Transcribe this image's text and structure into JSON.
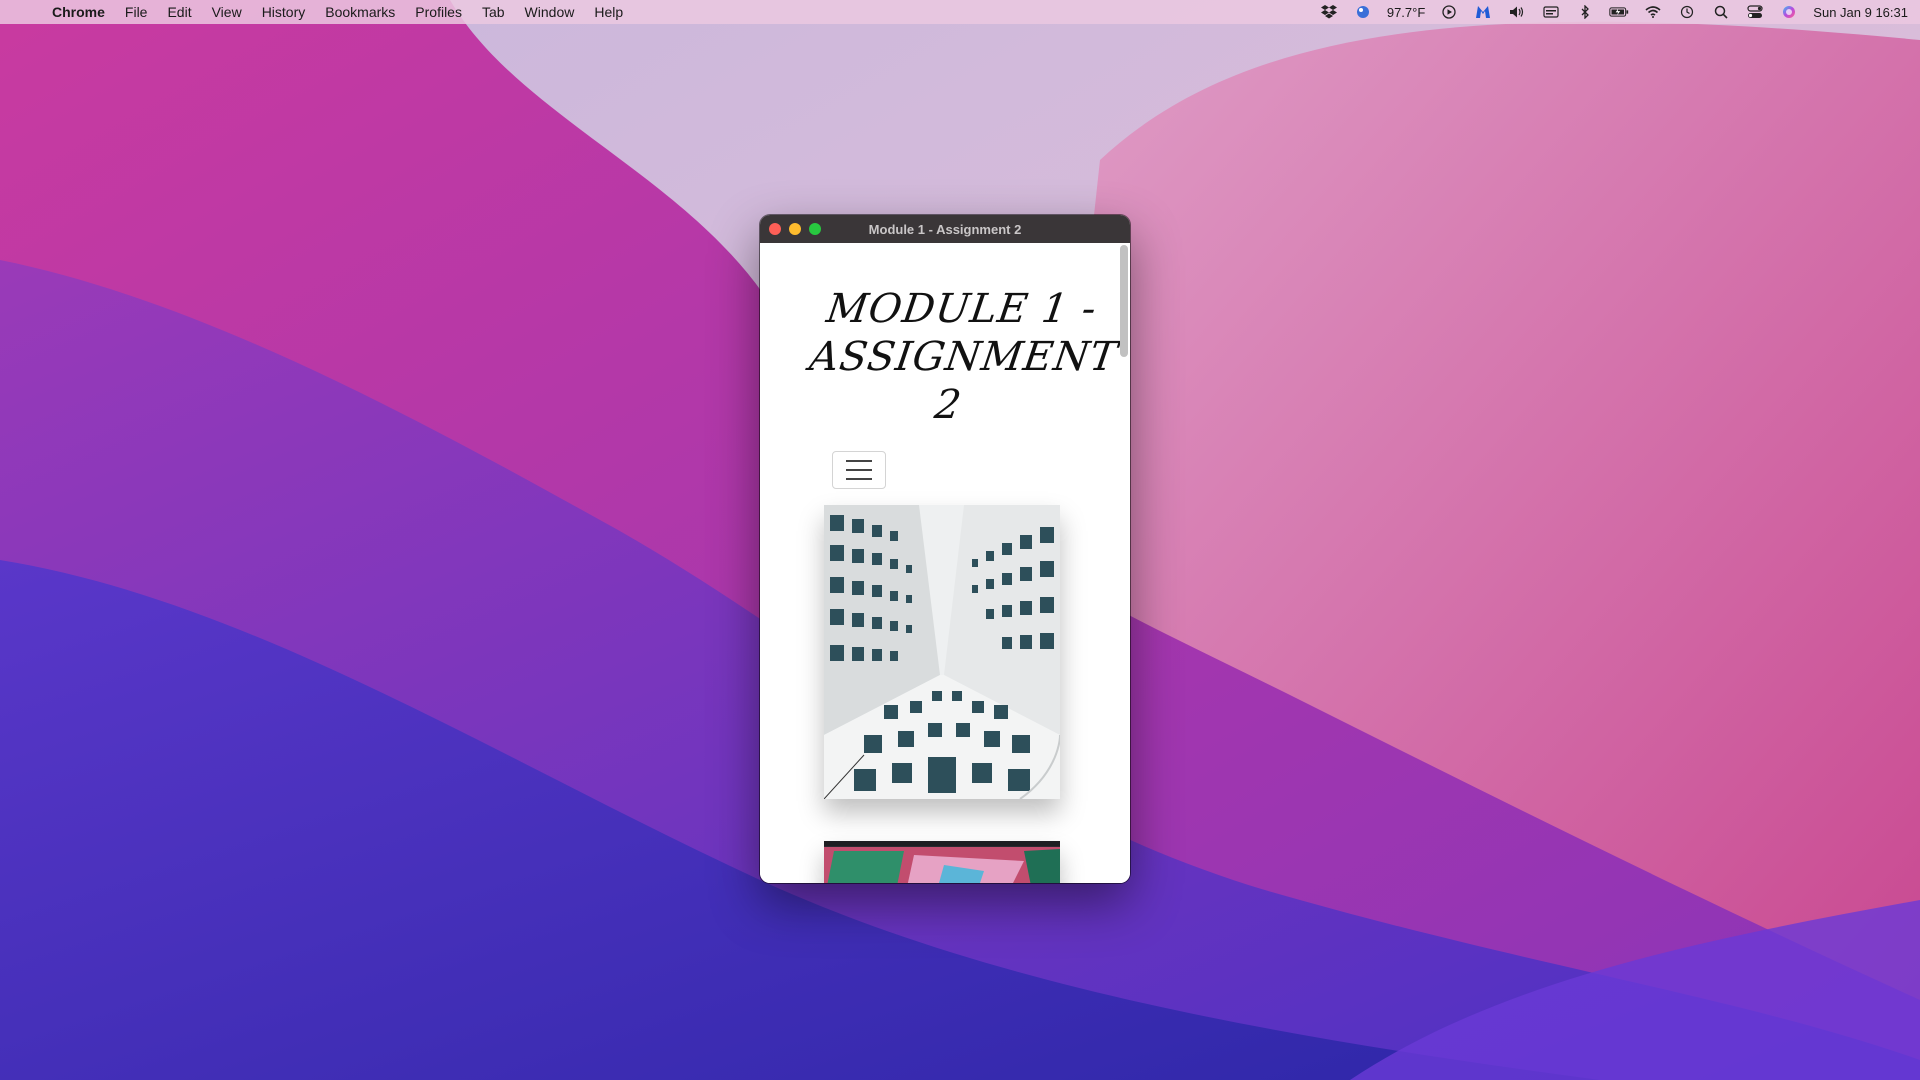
{
  "menubar": {
    "app_name": "Chrome",
    "menus": [
      "File",
      "Edit",
      "View",
      "History",
      "Bookmarks",
      "Profiles",
      "Tab",
      "Window",
      "Help"
    ],
    "weather": "97.7°F",
    "datetime": "Sun Jan 9  16:31"
  },
  "window": {
    "title": "Module 1 - Assignment 2"
  },
  "page": {
    "heading": "MODULE 1 - ASSIGNMENT 2"
  },
  "colors": {
    "accent_close": "#fe5f57",
    "accent_min": "#febc2e",
    "accent_max": "#28c840"
  }
}
